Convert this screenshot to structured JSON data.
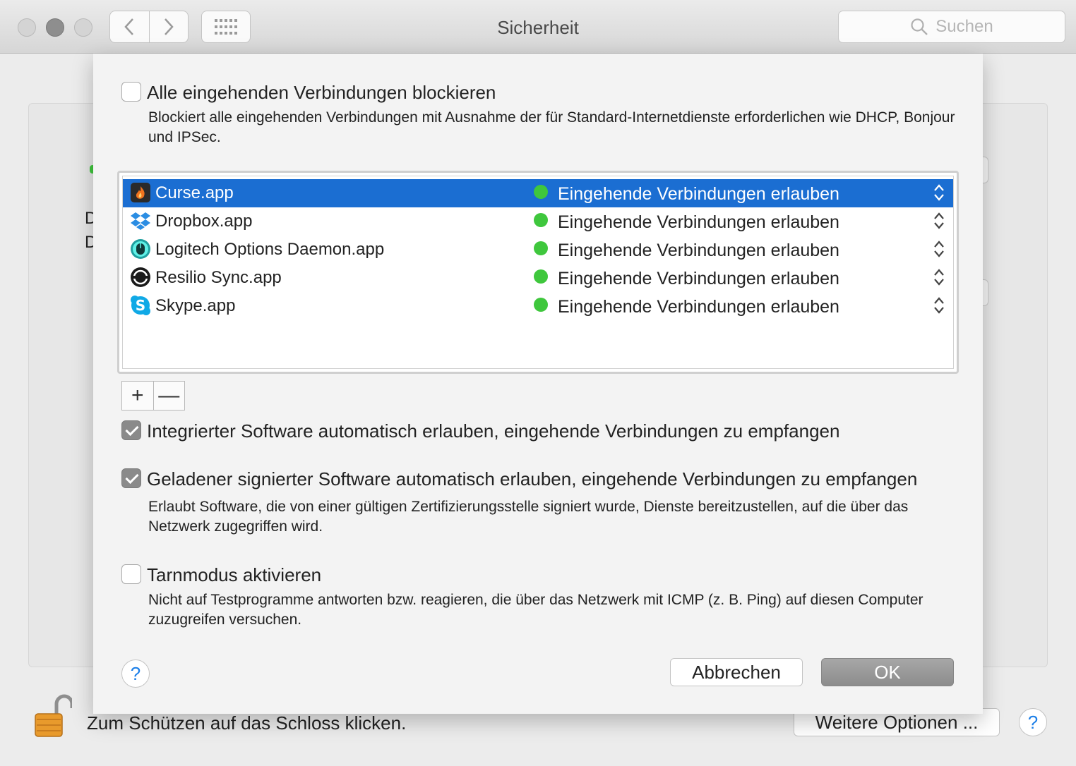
{
  "window": {
    "title": "Sicherheit",
    "search_placeholder": "Suchen"
  },
  "background": {
    "side_chars": [
      "D",
      "D"
    ],
    "lock_text": "Zum Schützen auf das Schloss klicken.",
    "more_options_label": "Weitere Optionen ...",
    "help_label": "?"
  },
  "sheet": {
    "block_all": {
      "label": "Alle eingehenden Verbindungen blockieren",
      "checked": false,
      "description": "Blockiert alle eingehenden Verbindungen mit Ausnahme der für Standard-Internetdienste erforderlichen wie DHCP, Bonjour und IPSec."
    },
    "apps": [
      {
        "name": "Curse.app",
        "status": "Eingehende Verbindungen erlauben",
        "status_color": "#3fc73d",
        "icon": "curse-icon",
        "selected": true
      },
      {
        "name": "Dropbox.app",
        "status": "Eingehende Verbindungen erlauben",
        "status_color": "#3fc73d",
        "icon": "dropbox-icon",
        "selected": false
      },
      {
        "name": "Logitech Options Daemon.app",
        "status": "Eingehende Verbindungen erlauben",
        "status_color": "#3fc73d",
        "icon": "logitech-icon",
        "selected": false
      },
      {
        "name": "Resilio Sync.app",
        "status": "Eingehende Verbindungen erlauben",
        "status_color": "#3fc73d",
        "icon": "resilio-icon",
        "selected": false
      },
      {
        "name": "Skype.app",
        "status": "Eingehende Verbindungen erlauben",
        "status_color": "#3fc73d",
        "icon": "skype-icon",
        "selected": false
      }
    ],
    "add_label": "+",
    "remove_label": "—",
    "builtin": {
      "label": "Integrierter Software automatisch erlauben, eingehende Verbindungen zu empfangen",
      "checked": true
    },
    "signed": {
      "label": "Geladener signierter Software automatisch erlauben, eingehende Verbindungen zu empfangen",
      "checked": true,
      "description": "Erlaubt Software, die von einer gültigen Zertifizierungsstelle signiert wurde, Dienste bereitzustellen, auf die über das Netzwerk zugegriffen wird."
    },
    "stealth": {
      "label": "Tarnmodus aktivieren",
      "checked": false,
      "description": "Nicht auf Testprogramme antworten bzw. reagieren, die über das Netzwerk mit ICMP (z. B. Ping) auf diesen Computer zuzugreifen versuchen."
    },
    "help_label": "?",
    "cancel_label": "Abbrechen",
    "ok_label": "OK"
  },
  "colors": {
    "selection": "#1b6ed2",
    "status_green": "#3fc73d",
    "help_blue": "#1a7ee8"
  }
}
